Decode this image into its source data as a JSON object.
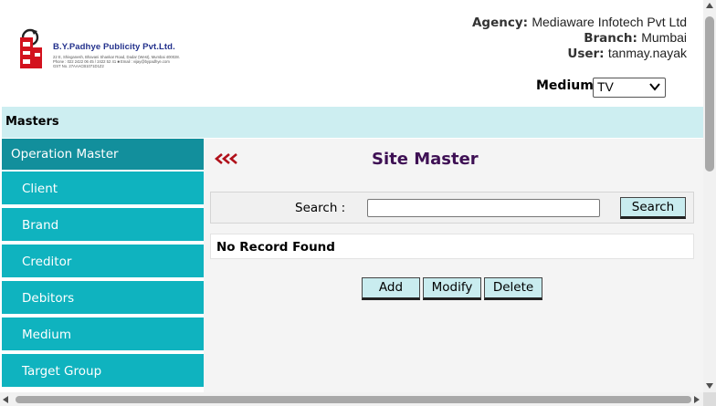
{
  "header": {
    "logo": {
      "title": "B.Y.Padhye Publicity Pvt.Ltd.",
      "lines": [
        "22 E, Shivganesh, Bhavani Shankar Road, Dadar (West), Mumbai 400028.",
        "Phone : 022 2422 06 45 / 2422 52 41  ■  Email : vijay@bypadhye.com",
        "GST No. 27AAACB1071D1Z2"
      ]
    },
    "agency_label": "Agency:",
    "agency_value": "Mediaware Infotech Pvt Ltd",
    "branch_label": "Branch:",
    "branch_value": "Mumbai",
    "user_label": "User:",
    "user_value": "tanmay.nayak",
    "medium_label": "Medium",
    "medium_value": "TV"
  },
  "masters_bar": {
    "label": "Masters"
  },
  "sidebar": {
    "header": "Operation Master",
    "items": [
      {
        "label": "Client"
      },
      {
        "label": "Brand"
      },
      {
        "label": "Creditor"
      },
      {
        "label": "Debitors"
      },
      {
        "label": "Medium"
      },
      {
        "label": "Target Group"
      }
    ]
  },
  "main": {
    "back_icon": "triple-chevron-left-icon",
    "title": "Site Master",
    "search_label": "Search :",
    "search_value": "",
    "search_button": "Search",
    "result_text": "No Record Found",
    "buttons": {
      "add": "Add",
      "modify": "Modify",
      "delete": "Delete"
    }
  },
  "colors": {
    "title": "#3e1054",
    "sidebar_header": "#128f9c",
    "sidebar_item": "#0fb3bf",
    "masters_bar": "#cdeef1",
    "button_bg": "#c9ecef",
    "back_arrows": "#b0101a"
  }
}
